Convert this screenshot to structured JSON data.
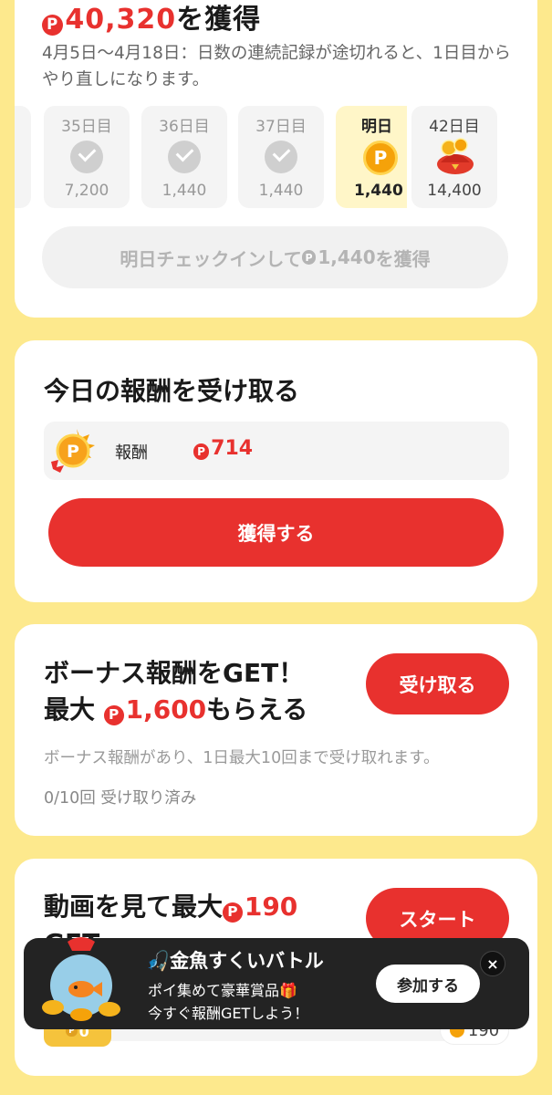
{
  "streak": {
    "title_amount": "40,320",
    "title_suffix": "を獲得",
    "description": "4月5日〜4月18日：日数の連続記録が途切れると、1日目からやり直しになります。",
    "days": [
      {
        "label": "35日目",
        "amount": "7,200",
        "state": "done"
      },
      {
        "label": "36日目",
        "amount": "1,440",
        "state": "done"
      },
      {
        "label": "37日目",
        "amount": "1,440",
        "state": "done"
      },
      {
        "label": "明日",
        "amount": "1,440",
        "state": "next"
      },
      {
        "label": "42日目",
        "amount": "14,400",
        "state": "bonus"
      }
    ],
    "button_prefix": "明日チェックインして",
    "button_amount": "1,440",
    "button_suffix": "を獲得"
  },
  "daily_reward": {
    "title": "今日の報酬を受け取る",
    "reward_label": "報酬",
    "reward_value": "714",
    "button_label": "獲得する"
  },
  "bonus": {
    "title_line1": "ボーナス報酬をGET！",
    "title_line2_prefix": "最大",
    "title_line2_amount": "1,600",
    "title_line2_suffix": "もらえる",
    "button_label": "受け取る",
    "description": "ボーナス報酬があり、1日最大10回まで受け取れます。",
    "progress": "0/10回 受け取り済み"
  },
  "video": {
    "title_prefix": "動画を見て最大",
    "title_amount": "190",
    "title_line2": "GET",
    "button_label": "スタート",
    "left_value": "0",
    "right_value": "190"
  },
  "banner": {
    "title": "🎣金魚すくいバトル",
    "line1": "ポイ集めて豪華賞品🎁",
    "line2": "今すぐ報酬GETしよう！",
    "join_label": "参加する",
    "close_label": "×"
  },
  "colors": {
    "background": "#fde98d",
    "accent_red": "#e8312e",
    "coin_gold": "#f5a20a"
  }
}
